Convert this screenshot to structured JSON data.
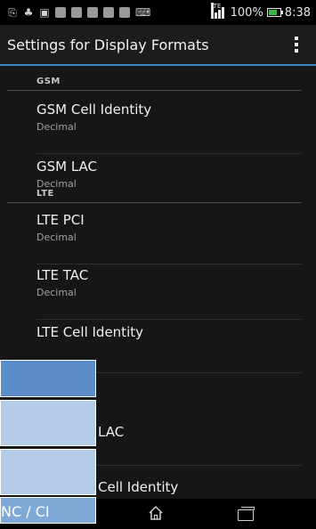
{
  "status_bar": {
    "battery_percent": "100%",
    "time": "8:38",
    "network": "LTE",
    "icons": [
      "usb-icon",
      "android-debug-icon",
      "notification-icon",
      "notification-icon",
      "notification-icon",
      "notification-icon",
      "notification-icon",
      "notification-icon",
      "keyboard-icon"
    ]
  },
  "action_bar": {
    "title": "Settings for Display Formats"
  },
  "settings": {
    "gsm_header": "GSM",
    "gsm_cell_identity": {
      "title": "GSM Cell Identity",
      "summary": "Decimal"
    },
    "gsm_lac": {
      "title": "GSM LAC",
      "summary": "Decimal"
    },
    "lte_header": "LTE",
    "lte_pci": {
      "title": "LTE PCI",
      "summary": "Decimal"
    },
    "lte_tac": {
      "title": "LTE TAC",
      "summary": "Decimal"
    },
    "lte_cell_identity": {
      "title": "LTE Cell Identity",
      "summary": ""
    },
    "partial_lac": {
      "title": "LAC",
      "summary": ""
    },
    "partial_cell_identity": {
      "title": "Cell Identity",
      "summary": ""
    }
  },
  "overlay_panel": {
    "bottom_text": "NC / CI"
  },
  "colors": {
    "accent": "#3d87c4",
    "panel_header": "#5b8ec9",
    "panel_row": "#b4cce6",
    "panel_bottom": "#7fa9d6"
  }
}
